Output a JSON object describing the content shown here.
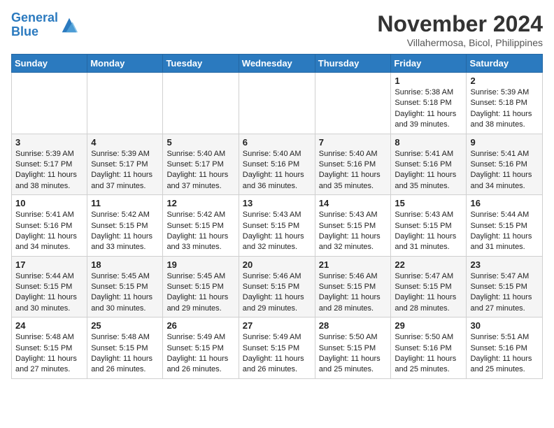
{
  "header": {
    "logo_line1": "General",
    "logo_line2": "Blue",
    "month_title": "November 2024",
    "location": "Villahermosa, Bicol, Philippines"
  },
  "days_of_week": [
    "Sunday",
    "Monday",
    "Tuesday",
    "Wednesday",
    "Thursday",
    "Friday",
    "Saturday"
  ],
  "weeks": [
    [
      {
        "day": "",
        "sunrise": "",
        "sunset": "",
        "daylight": ""
      },
      {
        "day": "",
        "sunrise": "",
        "sunset": "",
        "daylight": ""
      },
      {
        "day": "",
        "sunrise": "",
        "sunset": "",
        "daylight": ""
      },
      {
        "day": "",
        "sunrise": "",
        "sunset": "",
        "daylight": ""
      },
      {
        "day": "",
        "sunrise": "",
        "sunset": "",
        "daylight": ""
      },
      {
        "day": "1",
        "sunrise": "Sunrise: 5:38 AM",
        "sunset": "Sunset: 5:18 PM",
        "daylight": "Daylight: 11 hours and 39 minutes."
      },
      {
        "day": "2",
        "sunrise": "Sunrise: 5:39 AM",
        "sunset": "Sunset: 5:18 PM",
        "daylight": "Daylight: 11 hours and 38 minutes."
      }
    ],
    [
      {
        "day": "3",
        "sunrise": "Sunrise: 5:39 AM",
        "sunset": "Sunset: 5:17 PM",
        "daylight": "Daylight: 11 hours and 38 minutes."
      },
      {
        "day": "4",
        "sunrise": "Sunrise: 5:39 AM",
        "sunset": "Sunset: 5:17 PM",
        "daylight": "Daylight: 11 hours and 37 minutes."
      },
      {
        "day": "5",
        "sunrise": "Sunrise: 5:40 AM",
        "sunset": "Sunset: 5:17 PM",
        "daylight": "Daylight: 11 hours and 37 minutes."
      },
      {
        "day": "6",
        "sunrise": "Sunrise: 5:40 AM",
        "sunset": "Sunset: 5:16 PM",
        "daylight": "Daylight: 11 hours and 36 minutes."
      },
      {
        "day": "7",
        "sunrise": "Sunrise: 5:40 AM",
        "sunset": "Sunset: 5:16 PM",
        "daylight": "Daylight: 11 hours and 35 minutes."
      },
      {
        "day": "8",
        "sunrise": "Sunrise: 5:41 AM",
        "sunset": "Sunset: 5:16 PM",
        "daylight": "Daylight: 11 hours and 35 minutes."
      },
      {
        "day": "9",
        "sunrise": "Sunrise: 5:41 AM",
        "sunset": "Sunset: 5:16 PM",
        "daylight": "Daylight: 11 hours and 34 minutes."
      }
    ],
    [
      {
        "day": "10",
        "sunrise": "Sunrise: 5:41 AM",
        "sunset": "Sunset: 5:16 PM",
        "daylight": "Daylight: 11 hours and 34 minutes."
      },
      {
        "day": "11",
        "sunrise": "Sunrise: 5:42 AM",
        "sunset": "Sunset: 5:15 PM",
        "daylight": "Daylight: 11 hours and 33 minutes."
      },
      {
        "day": "12",
        "sunrise": "Sunrise: 5:42 AM",
        "sunset": "Sunset: 5:15 PM",
        "daylight": "Daylight: 11 hours and 33 minutes."
      },
      {
        "day": "13",
        "sunrise": "Sunrise: 5:43 AM",
        "sunset": "Sunset: 5:15 PM",
        "daylight": "Daylight: 11 hours and 32 minutes."
      },
      {
        "day": "14",
        "sunrise": "Sunrise: 5:43 AM",
        "sunset": "Sunset: 5:15 PM",
        "daylight": "Daylight: 11 hours and 32 minutes."
      },
      {
        "day": "15",
        "sunrise": "Sunrise: 5:43 AM",
        "sunset": "Sunset: 5:15 PM",
        "daylight": "Daylight: 11 hours and 31 minutes."
      },
      {
        "day": "16",
        "sunrise": "Sunrise: 5:44 AM",
        "sunset": "Sunset: 5:15 PM",
        "daylight": "Daylight: 11 hours and 31 minutes."
      }
    ],
    [
      {
        "day": "17",
        "sunrise": "Sunrise: 5:44 AM",
        "sunset": "Sunset: 5:15 PM",
        "daylight": "Daylight: 11 hours and 30 minutes."
      },
      {
        "day": "18",
        "sunrise": "Sunrise: 5:45 AM",
        "sunset": "Sunset: 5:15 PM",
        "daylight": "Daylight: 11 hours and 30 minutes."
      },
      {
        "day": "19",
        "sunrise": "Sunrise: 5:45 AM",
        "sunset": "Sunset: 5:15 PM",
        "daylight": "Daylight: 11 hours and 29 minutes."
      },
      {
        "day": "20",
        "sunrise": "Sunrise: 5:46 AM",
        "sunset": "Sunset: 5:15 PM",
        "daylight": "Daylight: 11 hours and 29 minutes."
      },
      {
        "day": "21",
        "sunrise": "Sunrise: 5:46 AM",
        "sunset": "Sunset: 5:15 PM",
        "daylight": "Daylight: 11 hours and 28 minutes."
      },
      {
        "day": "22",
        "sunrise": "Sunrise: 5:47 AM",
        "sunset": "Sunset: 5:15 PM",
        "daylight": "Daylight: 11 hours and 28 minutes."
      },
      {
        "day": "23",
        "sunrise": "Sunrise: 5:47 AM",
        "sunset": "Sunset: 5:15 PM",
        "daylight": "Daylight: 11 hours and 27 minutes."
      }
    ],
    [
      {
        "day": "24",
        "sunrise": "Sunrise: 5:48 AM",
        "sunset": "Sunset: 5:15 PM",
        "daylight": "Daylight: 11 hours and 27 minutes."
      },
      {
        "day": "25",
        "sunrise": "Sunrise: 5:48 AM",
        "sunset": "Sunset: 5:15 PM",
        "daylight": "Daylight: 11 hours and 26 minutes."
      },
      {
        "day": "26",
        "sunrise": "Sunrise: 5:49 AM",
        "sunset": "Sunset: 5:15 PM",
        "daylight": "Daylight: 11 hours and 26 minutes."
      },
      {
        "day": "27",
        "sunrise": "Sunrise: 5:49 AM",
        "sunset": "Sunset: 5:15 PM",
        "daylight": "Daylight: 11 hours and 26 minutes."
      },
      {
        "day": "28",
        "sunrise": "Sunrise: 5:50 AM",
        "sunset": "Sunset: 5:15 PM",
        "daylight": "Daylight: 11 hours and 25 minutes."
      },
      {
        "day": "29",
        "sunrise": "Sunrise: 5:50 AM",
        "sunset": "Sunset: 5:16 PM",
        "daylight": "Daylight: 11 hours and 25 minutes."
      },
      {
        "day": "30",
        "sunrise": "Sunrise: 5:51 AM",
        "sunset": "Sunset: 5:16 PM",
        "daylight": "Daylight: 11 hours and 25 minutes."
      }
    ]
  ]
}
